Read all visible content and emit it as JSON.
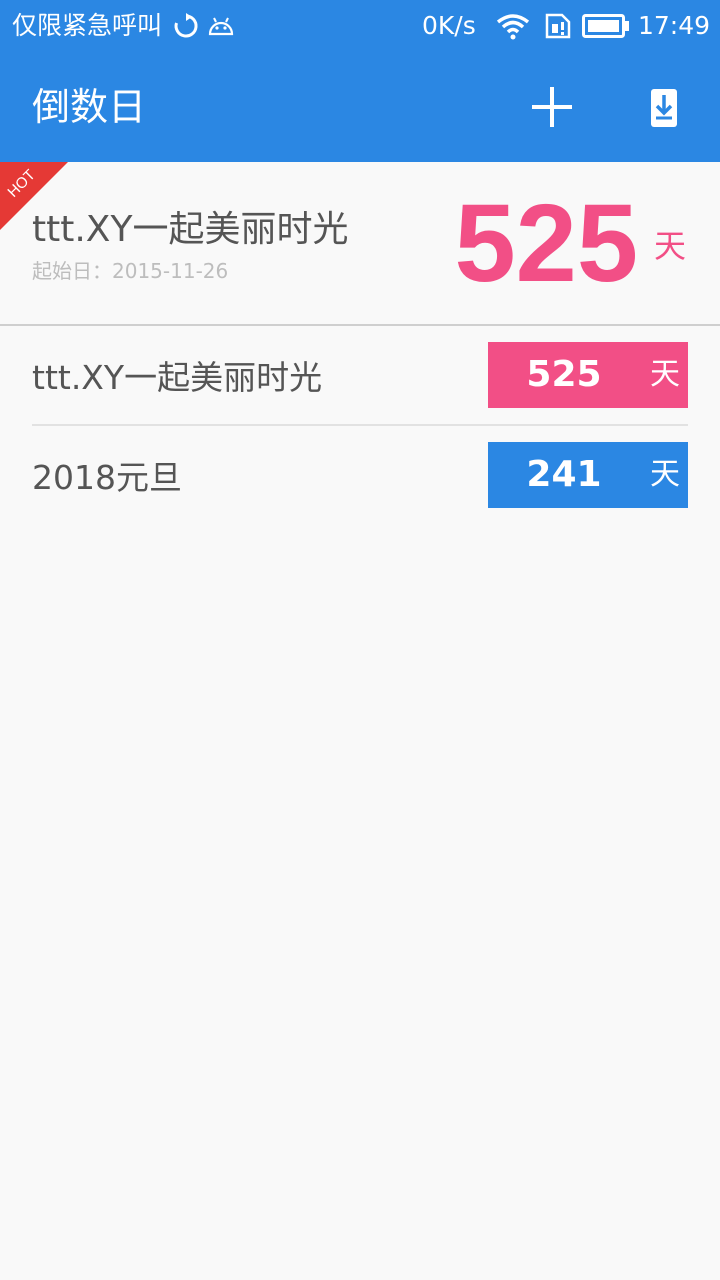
{
  "status_bar": {
    "carrier": "仅限紧急呼叫",
    "net_speed": "0K/s",
    "time": "17:49",
    "icons": [
      "sync-icon",
      "android-icon",
      "wifi-icon",
      "sim-icon",
      "battery-icon"
    ]
  },
  "app_bar": {
    "title": "倒数日",
    "actions": [
      "add-icon",
      "download-icon"
    ]
  },
  "hero": {
    "badge": "HOT",
    "name": "ttt.XY一起美丽时光",
    "start_date": "起始日：2015-11-26",
    "days": "525",
    "unit": "天"
  },
  "events": [
    {
      "name": "ttt.XY一起美丽时光",
      "days": "525",
      "unit": "天",
      "color": "#f24f86"
    },
    {
      "name": "2018元旦",
      "days": "241",
      "unit": "天",
      "color": "#2b87e3"
    }
  ],
  "colors": {
    "primary": "#2b87e3",
    "accent": "#f24f86",
    "hot_ribbon": "#e53935"
  }
}
